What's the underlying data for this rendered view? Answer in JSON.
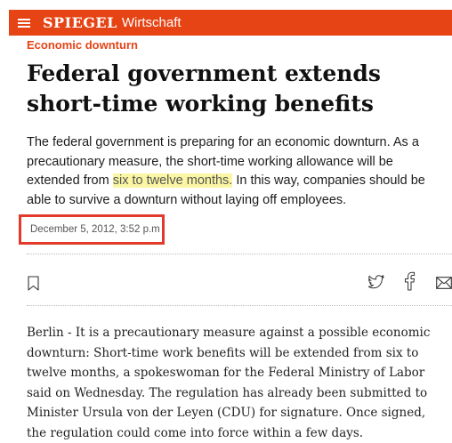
{
  "header": {
    "logo": "SPIEGEL",
    "section": "Wirtschaft",
    "accent_color": "#e64415",
    "menu_icon": "hamburger-menu-icon"
  },
  "article": {
    "kicker": "Economic downturn",
    "headline": "Federal government extends short-time working benefits",
    "lead_before": "The federal government is preparing for an economic downturn. As a precautionary measure, the short-time working allowance will be extended from ",
    "lead_highlight": "six to twelve months.",
    "lead_after": " In this way, companies should be able to survive a downturn without laying off employees.",
    "date": "December 5, 2012, 3:52 p.m",
    "body": "Berlin - It is a precautionary measure against a possible economic downturn: Short-time work benefits will be extended from six to twelve months, a spokeswoman for the Federal Ministry of Labor said on Wednesday. The regulation has already been submitted to Minister Ursula von der Leyen (CDU) for signature. Once signed, the regulation could come into force within a few days."
  },
  "share": {
    "icons": [
      "bookmark-icon",
      "twitter-icon",
      "facebook-icon",
      "mail-icon"
    ]
  },
  "highlight_color": "#fbf6a4",
  "annotation_box_color": "#e2392b"
}
